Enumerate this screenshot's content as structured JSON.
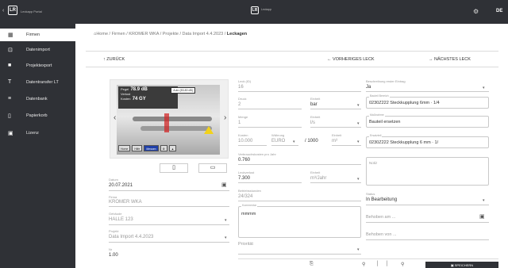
{
  "topbar": {
    "back_glyph": "‹",
    "logo": "LR",
    "app_name": "Leckapp Portal",
    "center_logo": "LR",
    "center_name": "Leckapp",
    "settings_icon": "gear-icon",
    "language": "DE"
  },
  "sidebar": {
    "items": [
      {
        "label": "Firmen",
        "icon": "building-icon",
        "glyph": "▦",
        "active": true
      },
      {
        "label": "Datenimport",
        "icon": "import-icon",
        "glyph": "⊡",
        "active": false
      },
      {
        "label": "Projektexport",
        "icon": "briefcase-icon",
        "glyph": "■",
        "active": false
      },
      {
        "label": "Datentransfer LT",
        "icon": "transfer-icon",
        "glyph": "T",
        "active": false
      },
      {
        "label": "Datenbank",
        "icon": "database-icon",
        "glyph": "≡",
        "active": false
      },
      {
        "label": "Papierkorb",
        "icon": "trash-icon",
        "glyph": "▯",
        "active": false
      },
      {
        "label": "Lizenz",
        "icon": "license-icon",
        "glyph": "▣",
        "active": false
      }
    ]
  },
  "breadcrumb": {
    "home": "Home",
    "trail": " / Firmen / KROMER WKA / Projekte / Data Import 4.4.2023 / ",
    "current": "Leckagen"
  },
  "actions": {
    "back": "ZURÜCK",
    "previous": "VORHERIGES LECK",
    "next": "NÄCHSTES LECK"
  },
  "image": {
    "lcd_line1": "Pegel",
    "lcd_value1": "78.9 dB",
    "lcd_line2": "Verlust",
    "lcd_line3": "Kosten",
    "lcd_value2": "74 GY",
    "auto_tag": "Auto (83-80 dB)",
    "buttons": [
      "Home",
      "Hilfe",
      "Messen"
    ],
    "prev_glyph": "‹",
    "next_glyph": "›",
    "delete_glyph": "🗑",
    "folder_glyph": "📁"
  },
  "left_form": {
    "date_label": "Datum",
    "date_value": "20.07.2021",
    "company_label": "Firma",
    "company_value": "KROMER WKA",
    "building_label": "Gebäude",
    "building_value": "HALLE 123",
    "project_label": "Projekt",
    "project_value": "Data Import 4.4.2023",
    "id_label": "Nr",
    "id_value": "1.00"
  },
  "mid_form": {
    "size_label": "Leck (ID)",
    "size_value": "16",
    "pressure_label": "Druck",
    "pressure_value": "2",
    "pressure_unit_label": "Einheit",
    "pressure_unit": "bar",
    "flow_label": "Menge",
    "flow_value": "1",
    "flow_unit_label": "Einheit",
    "flow_unit": "l/s",
    "cost_label": "Kosten",
    "cost_value": "10.000",
    "currency_label": "Währung",
    "currency_value": "EURO",
    "per_value": "/ 1000",
    "per_unit_label": "Einheit",
    "per_unit": "m³",
    "consumption_label": "Verbrauchskosten pro Jahr",
    "consumption_value": "0.760",
    "loss_label": "Leckverlust",
    "loss_value": "7.300",
    "loss_unit_label": "Einheit",
    "loss_unit": "m³/Jahr",
    "hours_label": "Betriebsstunden",
    "hours_value": "24/324",
    "comment_label": "Kommentar",
    "comment_value": "mmmm",
    "priority_label": "Priorität"
  },
  "right_form": {
    "description_label": "Beschreibung erster Eintrag",
    "description_value": "Ja",
    "component_label": "Bauteil Bereich",
    "component_value": "0230Z222 Steckkupplung 6mm · 1/4",
    "measure_label": "Maßnahme",
    "measure_value": "Bauteil ersetzen",
    "order_label": "Ersatzteil",
    "order_value": "0230Z222 Steckkupplung 6 mm · 1/",
    "notes_label": "Notiz",
    "status_label": "Status",
    "status_value": "In Bearbeitung",
    "repaired_label": "Behoben am ...",
    "repaired_by_label": "Behoben von ..."
  },
  "bottombar": {
    "icons": [
      "⎘",
      "▭",
      "⚲",
      "│",
      "│",
      "⚙"
    ],
    "save_label": "SPEICHERN"
  }
}
